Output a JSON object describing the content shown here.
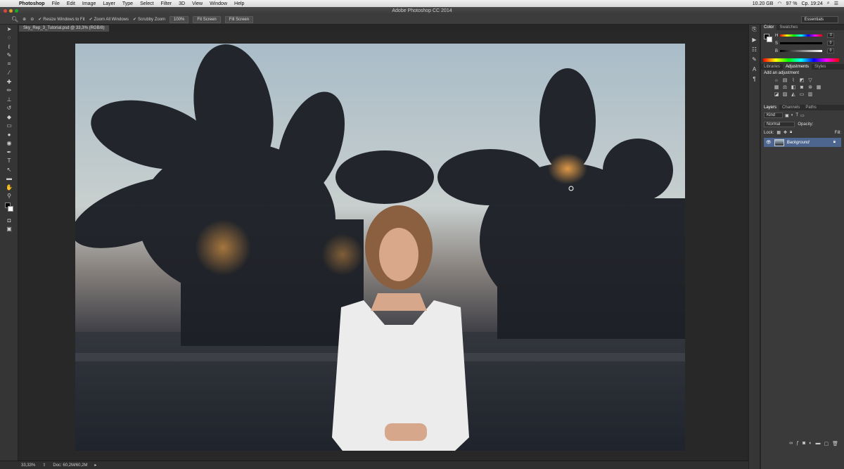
{
  "menubar": {
    "app": "Photoshop",
    "items": [
      "File",
      "Edit",
      "Image",
      "Layer",
      "Type",
      "Select",
      "Filter",
      "3D",
      "View",
      "Window",
      "Help"
    ],
    "status": {
      "storage": "10.20 GB",
      "battery": "97 %",
      "clock": "Ср. 19:24"
    }
  },
  "window": {
    "title": "Adobe Photoshop CC 2014"
  },
  "options": {
    "resize_windows": "Resize Windows to Fit",
    "zoom_all": "Zoom All Windows",
    "scrubby": "Scrubby Zoom",
    "btn_100": "100%",
    "btn_fit": "Fit Screen",
    "btn_fill": "Fill Screen",
    "workspace": "Essentials"
  },
  "document": {
    "tab": "Sky_Rep_3_Tutorial.psd @ 33,3% (RGB/8)"
  },
  "status": {
    "zoom": "33,33%",
    "doc": "Doc: 60,2M/60,2M"
  },
  "color_panel": {
    "tabs": [
      "Color",
      "Swatches"
    ],
    "channels": [
      "H",
      "S",
      "B"
    ],
    "values": [
      "0",
      "0",
      "0"
    ]
  },
  "adjustments_panel": {
    "tabs": [
      "Libraries",
      "Adjustments",
      "Styles"
    ],
    "heading": "Add an adjustment"
  },
  "layers_panel": {
    "tabs": [
      "Layers",
      "Channels",
      "Paths"
    ],
    "kind": "Kind",
    "blend": "Normal",
    "opacity_label": "Opacity:",
    "lock_label": "Lock:",
    "fill_label": "Fill:",
    "layer_name": "Background"
  }
}
